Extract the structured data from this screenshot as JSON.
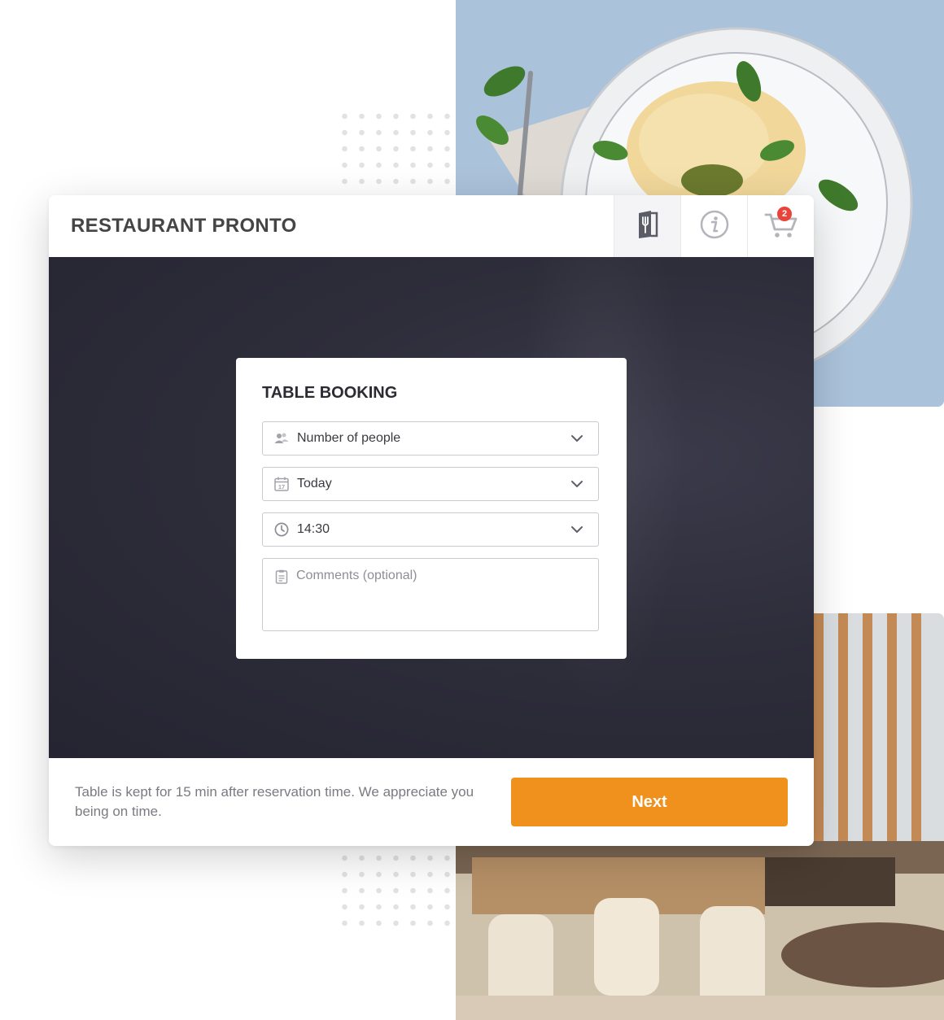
{
  "app": {
    "title": "RESTAURANT PRONTO",
    "cart_count": "2"
  },
  "header_icons": [
    "menu-book-icon",
    "info-icon",
    "cart-icon"
  ],
  "booking": {
    "title": "TABLE BOOKING",
    "people": {
      "value": "Number of people",
      "icon": "people-icon"
    },
    "date": {
      "value": "Today",
      "icon": "calendar-icon",
      "icon_day": "17"
    },
    "time": {
      "value": "14:30",
      "icon": "clock-icon"
    },
    "comments": {
      "placeholder": "Comments (optional)",
      "icon": "clipboard-icon"
    }
  },
  "footer": {
    "note": "Table is kept for 15 min after reservation time. We appreciate you being on time.",
    "next_label": "Next"
  },
  "colors": {
    "accent": "#f0901d",
    "badge": "#e8443a",
    "hero_dark": "#2e2d3a"
  }
}
